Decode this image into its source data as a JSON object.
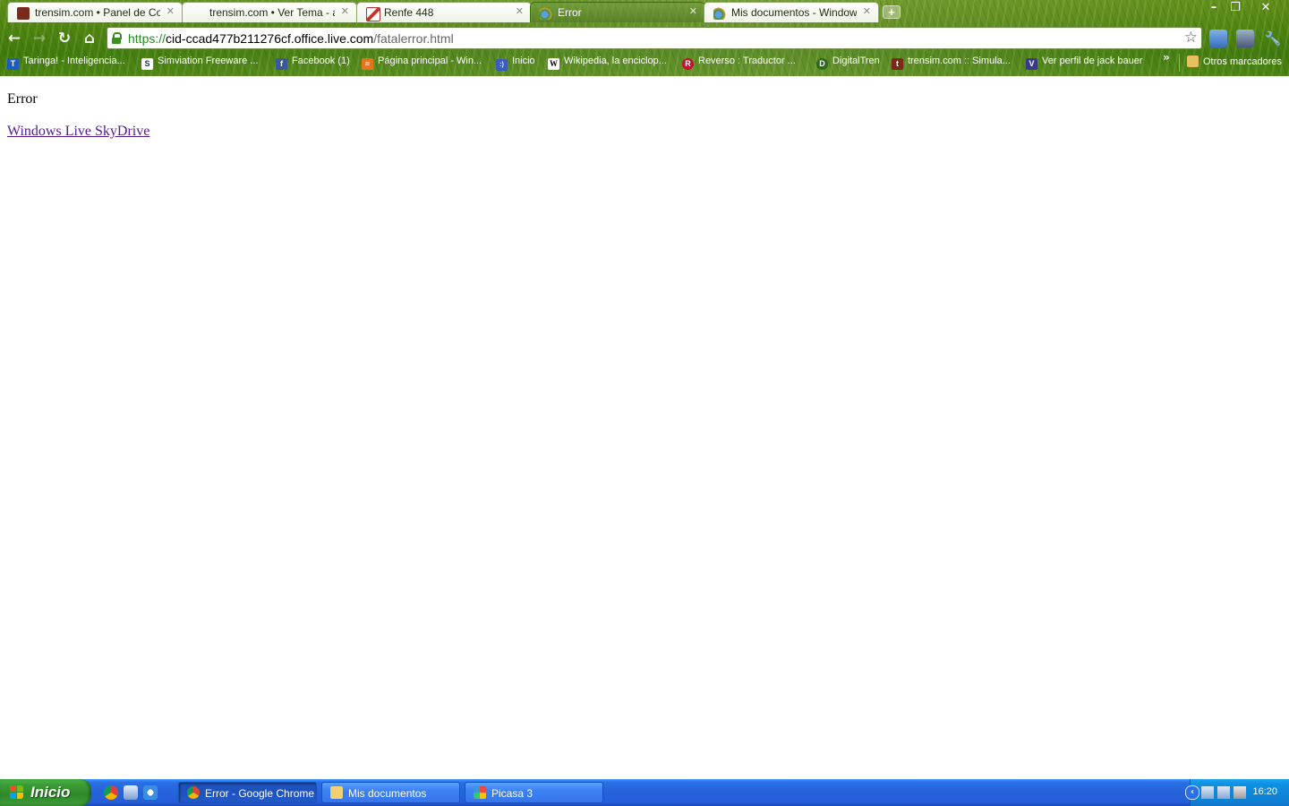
{
  "browser": {
    "tabs": [
      {
        "title": "trensim.com • Panel de Contro",
        "favicon": "trensim-icon",
        "active": true
      },
      {
        "title": "trensim.com • Ver Tema - activ",
        "favicon": "blank-icon",
        "active": true
      },
      {
        "title": "Renfe 448",
        "favicon": "notepad-icon",
        "active": true
      },
      {
        "title": "Error",
        "favicon": "windows-live-icon",
        "active": false
      },
      {
        "title": "Mis documentos - Windows Live",
        "favicon": "windows-live-icon",
        "active": true
      }
    ],
    "new_tab_symbol": "+",
    "window_controls": {
      "minimize": "–",
      "restore": "❐",
      "close": "✕"
    },
    "toolbar": {
      "back": "←",
      "forward": "→",
      "reload": "↻",
      "home": "⌂",
      "url_scheme": "https://",
      "url_host": "cid-ccad477b211276cf.office.live.com",
      "url_path": "/fatalerror.html",
      "star": "☆"
    },
    "bookmarks": [
      {
        "label": "Taringa! - Inteligencia...",
        "icon": "taringa-icon",
        "glyph": "T",
        "color": "#1e5bbf"
      },
      {
        "label": "Simviation Freeware ...",
        "icon": "simviation-icon",
        "glyph": "S",
        "color": "#ffffff"
      },
      {
        "label": "Facebook (1)",
        "icon": "facebook-icon",
        "glyph": "f",
        "color": "#3b5998"
      },
      {
        "label": "Página principal - Win...",
        "icon": "windows-live-icon",
        "glyph": "≈",
        "color": "#e8741a"
      },
      {
        "label": "Inicio",
        "icon": "smiley-icon",
        "glyph": ":)",
        "color": "#3b5bbf"
      },
      {
        "label": "Wikipedia, la enciclop...",
        "icon": "wikipedia-icon",
        "glyph": "W",
        "color": "#ffffff"
      },
      {
        "label": "Reverso : Traductor ...",
        "icon": "reverso-icon",
        "glyph": "R",
        "color": "#c8102e"
      },
      {
        "label": "DigitalTren",
        "icon": "digitaltren-icon",
        "glyph": "D",
        "color": "#2b6a1a"
      },
      {
        "label": "trensim.com :: Simula...",
        "icon": "trensim-icon",
        "glyph": "t",
        "color": "#7a2a1a"
      },
      {
        "label": "Ver perfil de jack bauer",
        "icon": "profile-icon",
        "glyph": "V",
        "color": "#3a3a8a"
      }
    ],
    "bookmarks_overflow": "»",
    "other_bookmarks": "Otros marcadores"
  },
  "page": {
    "error_text": "Error",
    "link_text": "Windows Live SkyDrive"
  },
  "taskbar": {
    "start_label": "Inicio",
    "quick_launch": [
      "chrome-icon",
      "outlook-icon",
      "ie-icon"
    ],
    "windows": [
      {
        "label": "Error - Google Chrome",
        "icon": "chrome-icon",
        "active": true
      },
      {
        "label": "Mis documentos",
        "icon": "folder-icon",
        "active": false
      },
      {
        "label": "Picasa 3",
        "icon": "picasa-icon",
        "active": false
      }
    ],
    "clock": "16:20"
  },
  "colors": {
    "chrome_theme": "#4f8410",
    "taskbar_blue": "#245edb",
    "start_green": "#3a9c35",
    "visited_link": "#551a8b"
  }
}
